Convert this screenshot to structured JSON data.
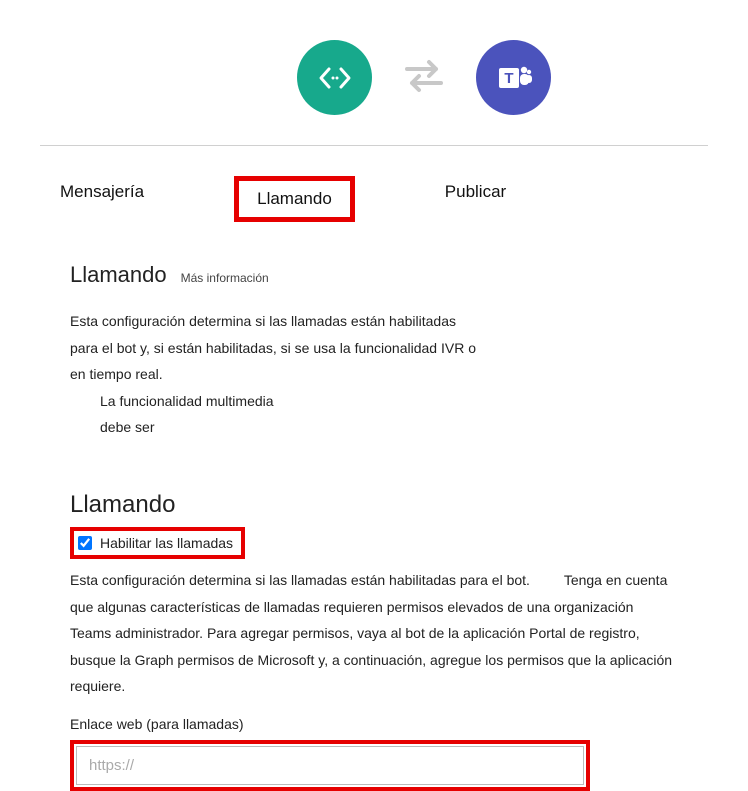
{
  "header": {
    "left_icon": "code-angle-icon",
    "arrows_icon": "swap-arrows-icon",
    "right_icon": "teams-icon"
  },
  "tabs": {
    "messaging": "Mensajería",
    "calling": "Llamando",
    "publish": "Publicar"
  },
  "section1": {
    "title": "Llamando",
    "more_info": "Más información",
    "desc_a": "Esta configuración determina si las llamadas están habilitadas para el bot y, si están habilitadas, si se usa la funcionalidad IVR o en tiempo real.",
    "desc_b": "La funcionalidad multimedia debe ser"
  },
  "section2": {
    "title": "Llamando",
    "checkbox_label": "Habilitar las llamadas",
    "para_a": "Esta configuración determina si las llamadas están habilitadas para el bot.",
    "para_b": "Tenga en cuenta que algunas características de llamadas requieren permisos elevados de una organización Teams administrador. Para agregar permisos, vaya al bot de la aplicación Portal de registro, busque la Graph permisos de Microsoft y, a continuación, agregue los permisos que la aplicación requiere.",
    "webhook_label": "Enlace web (para llamadas)",
    "webhook_placeholder": "https://"
  }
}
